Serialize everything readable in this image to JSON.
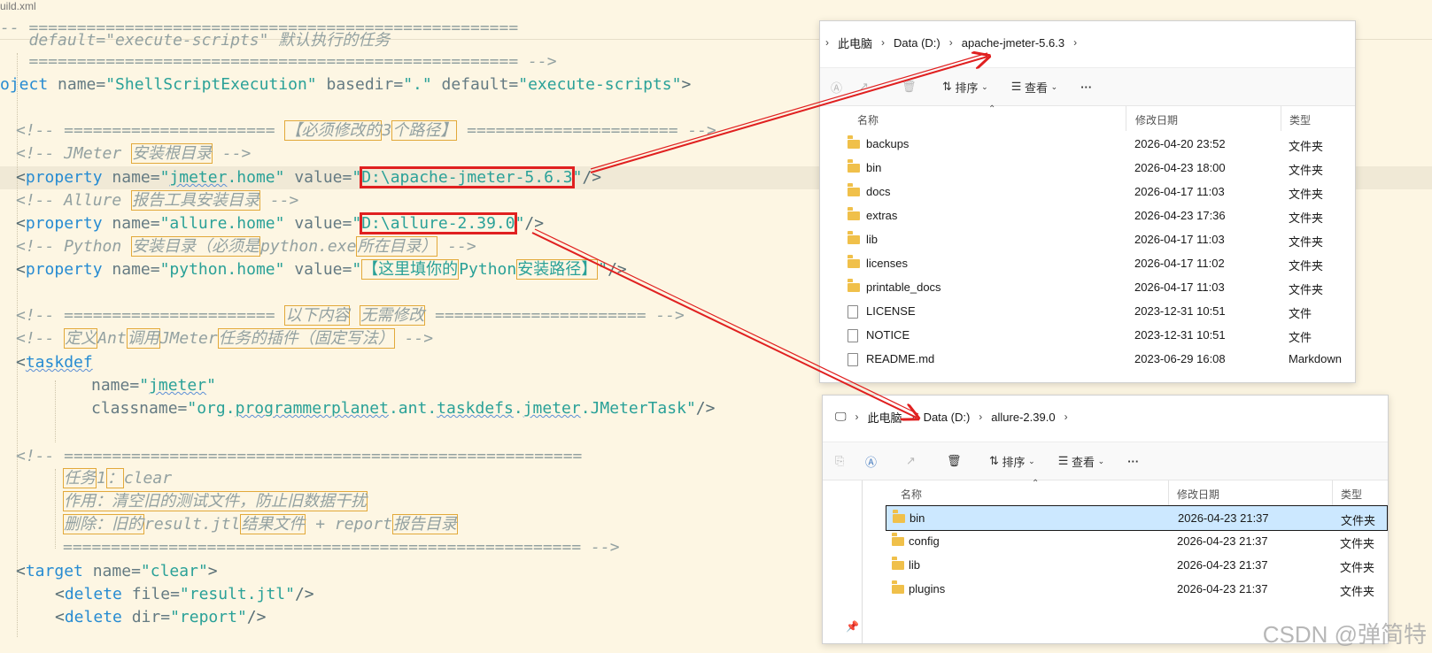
{
  "editor": {
    "tab_name": "uild.xml",
    "lines": [
      {
        "text": "-- ==================================================="
      },
      {
        "text": "   default=\"execute-scripts\" 默认执行的任务"
      },
      {
        "text": "   =================================================== -->"
      },
      {
        "text": "oject name=\"ShellScriptExecution\" basedir=\".\" default=\"execute-scripts\">"
      }
    ],
    "c_must_modify": "【必须修改的",
    "c_3": "3",
    "c_paths": "个路径】",
    "c_jmeter_prefix": "<!-- JMeter ",
    "c_jmeter_box": "安装根目录",
    "jmeter_value": "D:\\apache-jmeter-5.6.3",
    "c_allure_prefix": "<!-- Allure ",
    "c_allure_box": "报告工具安装目录",
    "allure_value": "D:\\allure-2.39.0",
    "c_python_prefix": "<!-- Python ",
    "c_python_box1": "安装目录（必须是",
    "c_python_mid": "python.exe",
    "c_python_box2": "所在目录）",
    "python_box1": "【这里填你的",
    "python_mid": "Python",
    "python_box2": "安装路径】",
    "c_below": "以下内容",
    "c_no_modify": "无需修改",
    "c_def": "定义",
    "c_ant": "Ant",
    "c_call": "调用",
    "c_jm": "JMeter",
    "c_plugin": "任务的插件（固定写法）",
    "taskdef_tag": "taskdef",
    "taskdef_name_val": "jmeter",
    "taskdef_class_pre": "org.",
    "taskdef_class_a": "programmerplanet",
    "taskdef_class_mid": ".ant.",
    "taskdef_class_b": "taskdefs",
    "taskdef_class_dot": ".",
    "taskdef_class_c": "jmeter",
    "taskdef_class_post": ".JMeterTask",
    "task1_label": "任务",
    "task1_num": "1",
    "task1_colon": "：",
    "task1_clear": "clear",
    "task1_desc": "作用：清空旧的测试文件，防止旧数据干扰",
    "task1_del_a": "删除：旧的",
    "task1_del_b": "result.jtl",
    "task1_del_c": "结果文件",
    "task1_del_d": " + report",
    "task1_del_e": "报告目录",
    "target_name": "clear",
    "delete_file": "result.jtl",
    "delete_dir": "report"
  },
  "explorer1": {
    "breadcrumb": [
      "此电脑",
      "Data (D:)",
      "apache-jmeter-5.6.3"
    ],
    "sort_label": "排序",
    "view_label": "查看",
    "more_label": "···",
    "col_name": "名称",
    "col_date": "修改日期",
    "col_type": "类型",
    "rows": [
      {
        "name": "backups",
        "date": "2026-04-20 23:52",
        "type": "文件夹",
        "icon": "folder-icon"
      },
      {
        "name": "bin",
        "date": "2026-04-23 18:00",
        "type": "文件夹",
        "icon": "folder-icon"
      },
      {
        "name": "docs",
        "date": "2026-04-17 11:03",
        "type": "文件夹",
        "icon": "folder-icon"
      },
      {
        "name": "extras",
        "date": "2026-04-23 17:36",
        "type": "文件夹",
        "icon": "folder-icon"
      },
      {
        "name": "lib",
        "date": "2026-04-17 11:03",
        "type": "文件夹",
        "icon": "folder-icon"
      },
      {
        "name": "licenses",
        "date": "2026-04-17 11:02",
        "type": "文件夹",
        "icon": "folder-icon"
      },
      {
        "name": "printable_docs",
        "date": "2026-04-17 11:03",
        "type": "文件夹",
        "icon": "folder-icon"
      },
      {
        "name": "LICENSE",
        "date": "2023-12-31 10:51",
        "type": "文件",
        "icon": "file-icon"
      },
      {
        "name": "NOTICE",
        "date": "2023-12-31 10:51",
        "type": "文件",
        "icon": "file-icon"
      },
      {
        "name": "README.md",
        "date": "2023-06-29 16:08",
        "type": "Markdown",
        "icon": "file-icon"
      }
    ]
  },
  "explorer2": {
    "breadcrumb": [
      "此电脑",
      "Data (D:)",
      "allure-2.39.0"
    ],
    "sort_label": "排序",
    "view_label": "查看",
    "more_label": "···",
    "col_name": "名称",
    "col_date": "修改日期",
    "col_type": "类型",
    "rows": [
      {
        "name": "bin",
        "date": "2026-04-23 21:37",
        "type": "文件夹",
        "icon": "folder-icon"
      },
      {
        "name": "config",
        "date": "2026-04-23 21:37",
        "type": "文件夹",
        "icon": "folder-icon"
      },
      {
        "name": "lib",
        "date": "2026-04-23 21:37",
        "type": "文件夹",
        "icon": "folder-icon"
      },
      {
        "name": "plugins",
        "date": "2026-04-23 21:37",
        "type": "文件夹",
        "icon": "folder-icon"
      }
    ]
  },
  "watermark": "CSDN @弹简特",
  "colors": {
    "annotation_red": "#e02020",
    "comment_box": "#e2a93a",
    "editor_bg": "#fdf6e3"
  }
}
